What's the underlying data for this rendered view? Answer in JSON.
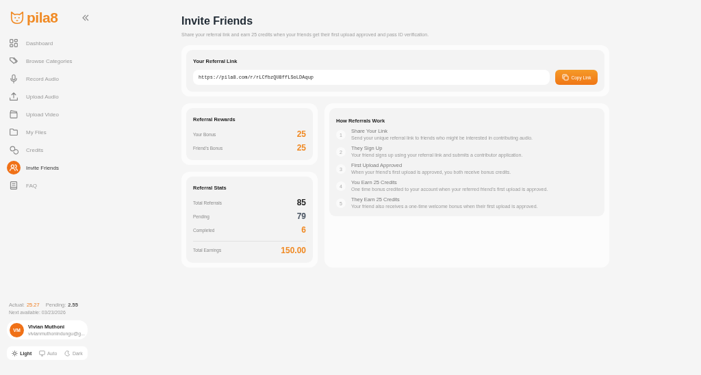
{
  "brand": "pila8",
  "nav": [
    {
      "label": "Dashboard",
      "selected": false
    },
    {
      "label": "Browse Categories",
      "selected": false
    },
    {
      "label": "Record Audio",
      "selected": false
    },
    {
      "label": "Upload Audio",
      "selected": false
    },
    {
      "label": "Upload Video",
      "selected": false
    },
    {
      "label": "My Files",
      "selected": false
    },
    {
      "label": "Credits",
      "selected": false
    },
    {
      "label": "Invite Friends",
      "selected": true
    },
    {
      "label": "FAQ",
      "selected": false
    }
  ],
  "balance": {
    "actual_label": "Actual:",
    "actual": "25.27",
    "pending_label": "Pending:",
    "pending": "2.55",
    "next": "Next available: 03/23/2026"
  },
  "user": {
    "initials": "VM",
    "name": "Vivian Muthoni",
    "email": "vivianmuthonindungu@g..."
  },
  "theme": [
    {
      "label": "Light",
      "selected": true
    },
    {
      "label": "Auto",
      "selected": false
    },
    {
      "label": "Dark",
      "selected": false
    }
  ],
  "page": {
    "title": "Invite Friends",
    "subtitle": "Share your referral link and earn 25 credits when your friends get their first upload approved and pass ID verification."
  },
  "referral_link": {
    "heading": "Your Referral Link",
    "value": "https://pila8.com/r/rLCfbzQU8ffLSoLDAqup",
    "button": "Copy Link"
  },
  "rewards": {
    "heading": "Referral Rewards",
    "rows": [
      {
        "label": "Your Bonus",
        "value": "25",
        "kind": "accent"
      },
      {
        "label": "Friend's Bonus",
        "value": "25",
        "kind": "accent"
      }
    ]
  },
  "stats": {
    "heading": "Referral Stats",
    "rows": [
      {
        "label": "Total Referrals",
        "value": "85",
        "kind": "dark"
      },
      {
        "label": "Pending",
        "value": "79",
        "kind": "muted"
      },
      {
        "label": "Completed",
        "value": "6",
        "kind": "accent"
      }
    ],
    "total": {
      "label": "Total Earnings",
      "value": "150.00"
    }
  },
  "how": {
    "heading": "How Referrals Work",
    "steps": [
      {
        "number": "1",
        "title": "Share Your Link",
        "text": "Send your unique referral link to friends who might be interested in contributing audio."
      },
      {
        "number": "2",
        "title": "They Sign Up",
        "text": "Your friend signs up using your referral link and submits a contributor application."
      },
      {
        "number": "3",
        "title": "First Upload Approved",
        "text": "When your friend's first upload is approved, you both receive bonus credits."
      },
      {
        "number": "4",
        "title": "You Earn 25 Credits",
        "text": "One time bonus credited to your account when your referred friend's first upload is approved."
      },
      {
        "number": "5",
        "title": "They Earn 25 Credits",
        "text": "Your friend also receives a one-time welcome bonus when their first upload is approved."
      }
    ]
  }
}
